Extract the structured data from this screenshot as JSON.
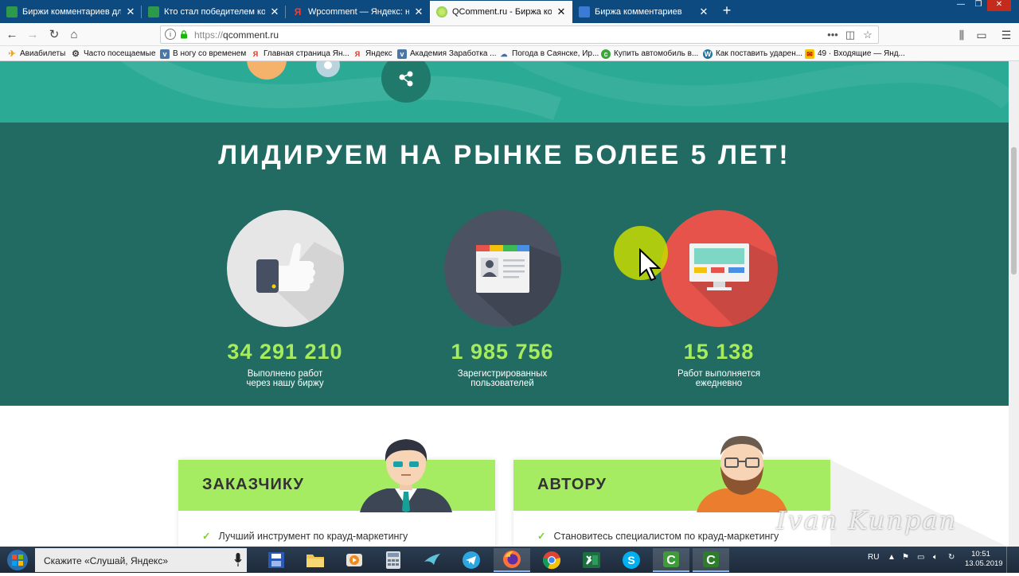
{
  "browser": {
    "tabs": [
      {
        "title": "Биржи комментариев для зар",
        "icon_color": "#2c9a4a",
        "active": false
      },
      {
        "title": "Кто стал победителем конкур",
        "icon_color": "#2c9a4a",
        "active": false
      },
      {
        "title": "Wpcomment — Яндекс: нашл",
        "icon_color": "#e0301e",
        "active": false
      },
      {
        "title": "QComment.ru - Биржа комме",
        "icon_color": "#9ad35a",
        "active": true
      },
      {
        "title": "Биржа комментариев",
        "icon_color": "#3b7bd4",
        "active": false
      }
    ],
    "url_protocol": "https://",
    "url_host": "qcomment.ru",
    "bookmarks": [
      {
        "label": "Авиабилеты",
        "icon": "plane-icon"
      },
      {
        "label": "Часто посещаемые",
        "icon": "gear-icon"
      },
      {
        "label": "В ногу со временем",
        "icon": "vk-icon"
      },
      {
        "label": "Главная страница Ян...",
        "icon": "yandex-icon"
      },
      {
        "label": "Яндекс",
        "icon": "yandex-icon"
      },
      {
        "label": "Академия Заработка ...",
        "icon": "vk-icon"
      },
      {
        "label": "Погода в Саянске, Ир...",
        "icon": "weather-icon"
      },
      {
        "label": "Купить автомобиль в...",
        "icon": "c-icon"
      },
      {
        "label": "Как поставить ударен...",
        "icon": "wordpress-icon"
      },
      {
        "label": "49 · Входящие — Янд...",
        "icon": "mail-icon"
      }
    ]
  },
  "page": {
    "stats_title": "ЛИДИРУЕМ НА РЫНКЕ БОЛЕЕ 5 ЛЕТ!",
    "stats": [
      {
        "number": "34 291 210",
        "desc_line1": "Выполнено работ",
        "desc_line2": "через нашу биржу",
        "icon": "thumbs-up-icon",
        "circle_color": "#e6e6e6"
      },
      {
        "number": "1 985 756",
        "desc_line1": "Зарегистрированных",
        "desc_line2": "пользователей",
        "icon": "profile-card-icon",
        "circle_color": "#4b5262"
      },
      {
        "number": "15 138",
        "desc_line1": "Работ выполняется",
        "desc_line2": "ежедневно",
        "icon": "monitor-icon",
        "circle_color": "#e5534b"
      }
    ],
    "cards": [
      {
        "title": "ЗАКАЗЧИКУ",
        "item": "Лучший инструмент по крауд-маркетингу",
        "avatar": "businessman-avatar"
      },
      {
        "title": "АВТОРУ",
        "item": "Становитесь специалистом по крауд-маркетингу",
        "avatar": "bearded-man-avatar"
      }
    ],
    "watermark": "Ivan Kunpan"
  },
  "taskbar": {
    "search_placeholder": "Скажите «Слушай, Яндекс»",
    "apps": [
      "file-manager-icon",
      "folder-icon",
      "media-player-icon",
      "calculator-icon",
      "bird-icon",
      "telegram-icon",
      "firefox-icon",
      "chrome-icon",
      "excel-icon",
      "skype-icon",
      "camtasia-icon",
      "camtasia-recorder-icon"
    ],
    "lang": "RU",
    "time": "10:51",
    "date": "13.05.2019"
  },
  "colors": {
    "stats_bg": "#216b63",
    "hero_bg": "#2bab96",
    "accent_green": "#a6ec5c",
    "card_head": "#a5ec62"
  }
}
